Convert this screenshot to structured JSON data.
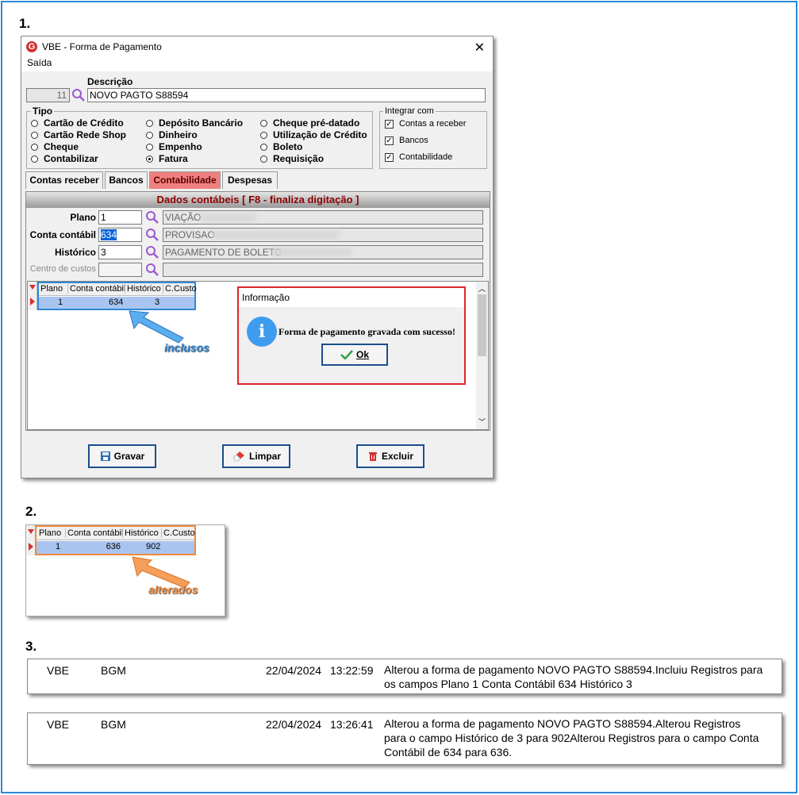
{
  "steps": [
    "1.",
    "2.",
    "3."
  ],
  "window": {
    "logo": "G",
    "title": "VBE - Forma de Pagamento",
    "close": "✕",
    "menu": "Saída"
  },
  "form": {
    "code": "11",
    "descricao_label": "Descrição",
    "descricao_value": "NOVO PAGTO S88594",
    "tipo_label": "Tipo",
    "tipo_options": [
      {
        "label": "Cartão de Crédito",
        "selected": false
      },
      {
        "label": "Cartão Rede Shop",
        "selected": false
      },
      {
        "label": "Cheque",
        "selected": false
      },
      {
        "label": "Contabilizar",
        "selected": false
      },
      {
        "label": "Depósito Bancário",
        "selected": false
      },
      {
        "label": "Dinheiro",
        "selected": false
      },
      {
        "label": "Empenho",
        "selected": false
      },
      {
        "label": "Fatura",
        "selected": true
      },
      {
        "label": "Cheque pré-datado",
        "selected": false
      },
      {
        "label": "Utilização de Crédito",
        "selected": false
      },
      {
        "label": "Boleto",
        "selected": false
      },
      {
        "label": "Requisição",
        "selected": false
      }
    ],
    "integrar_label": "Integrar com",
    "integrar": [
      {
        "label": "Contas a receber",
        "checked": true
      },
      {
        "label": "Bancos",
        "checked": true
      },
      {
        "label": "Contabilidade",
        "checked": true
      }
    ],
    "check_mark": "✓"
  },
  "tabs": [
    {
      "label": "Contas receber",
      "active": false
    },
    {
      "label": "Bancos",
      "active": false
    },
    {
      "label": "Contabilidade",
      "active": true
    },
    {
      "label": "Despesas",
      "active": false
    }
  ],
  "panel": {
    "header": "Dados contábeis [ F8 - finaliza digitação ]",
    "plano_label": "Plano",
    "plano_value": "1",
    "plano_desc": "VIAÇÃO",
    "conta_label": "Conta contábil",
    "conta_value": "634",
    "conta_desc": "PROVISAO",
    "historico_label": "Histórico",
    "historico_value": "3",
    "historico_desc": "PAGAMENTO DE BOLETO",
    "centro_label": "Centro de custos"
  },
  "grid": {
    "columns": [
      "Plano",
      "Conta contábil",
      "Histórico",
      "C.Custo"
    ],
    "row": [
      "1",
      "634",
      "3",
      ""
    ]
  },
  "grid2": {
    "columns": [
      "Plano",
      "Conta contábil",
      "Histórico",
      "C.Custo"
    ],
    "row": [
      "1",
      "636",
      "902",
      ""
    ]
  },
  "callouts": {
    "inclusos": "inclusos",
    "alterados": "alterados"
  },
  "dialog": {
    "title": "Informação",
    "icon": "i",
    "message": "Forma de pagamento gravada com sucesso!",
    "ok": "Ok"
  },
  "buttons": {
    "gravar": "Gravar",
    "limpar": "Limpar",
    "excluir": "Excluir"
  },
  "log": [
    {
      "system": "VBE",
      "user": "BGM",
      "date": "22/04/2024",
      "time": "13:22:59",
      "message": "Alterou a forma de pagamento NOVO PAGTO S88594.Incluiu Registros para os campos Plano 1 Conta Contábil 634 Histórico 3"
    },
    {
      "system": "VBE",
      "user": "BGM",
      "date": "22/04/2024",
      "time": "13:26:41",
      "message": "Alterou a forma de pagamento NOVO PAGTO S88594.Alterou Registros para o campo Histórico de 3 para 902Alterou Registros para o campo Conta Contábil de 634 para 636."
    }
  ],
  "colors": {
    "frame": "#2e89d6",
    "tab_active": "#f08080",
    "grid_row": "#a9c4f0",
    "inclusos_highlight": "#2e89d6",
    "alterados_highlight": "#f08a3c",
    "dialog_border": "#e0262c"
  }
}
